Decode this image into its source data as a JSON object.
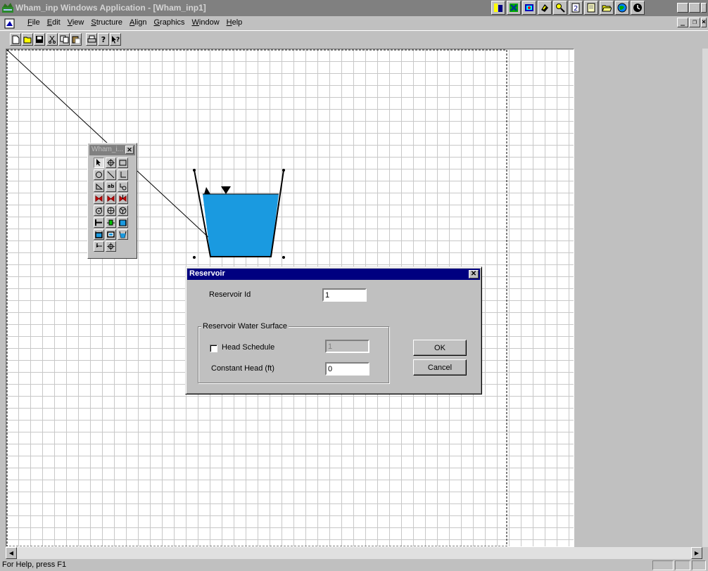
{
  "window": {
    "title": "Wham_inp Windows Application - [Wham_inp1]",
    "title_bar_color": "#808080"
  },
  "office_shortcut_bar": [
    "office-icon",
    "excel-icon",
    "schedule-icon",
    "binder-icon",
    "search-icon",
    "help-icon",
    "document-icon",
    "open-folder-icon",
    "internet-icon",
    "clock-icon"
  ],
  "menu": [
    {
      "accel": "F",
      "rest": "ile"
    },
    {
      "accel": "E",
      "rest": "dit"
    },
    {
      "accel": "V",
      "rest": "iew"
    },
    {
      "accel": "S",
      "rest": "tructure"
    },
    {
      "accel": "A",
      "rest": "lign"
    },
    {
      "accel": "G",
      "rest": "raphics"
    },
    {
      "accel": "W",
      "rest": "indow"
    },
    {
      "accel": "H",
      "rest": "elp"
    }
  ],
  "toolbar": {
    "buttons": [
      "new-file-icon",
      "open-file-icon",
      "save-icon",
      "cut-icon",
      "copy-icon",
      "paste-icon",
      "print-icon",
      "about-icon",
      "context-help-icon"
    ]
  },
  "palette": {
    "title": "Wham_i...",
    "close": "✕",
    "tools": [
      "select-arrow-icon",
      "node-icon",
      "rectangle-icon",
      "circle-icon",
      "line-icon",
      "elbow-line-icon",
      "triangle-icon",
      "text-tool-icon",
      "junction-tool-icon",
      "valve-red-icon",
      "check-valve-red-icon",
      "relief-valve-red-icon",
      "pump-icon",
      "turbine-icon",
      "fan-icon",
      "pipe-tee-icon",
      "pipe-green-icon",
      "tank-blue-icon",
      "surge-tank-blue-icon",
      "box-blue-icon",
      "reservoir-blue-icon",
      "pointer-tool-icon",
      "crosshair-tool-icon"
    ]
  },
  "dialog": {
    "title": "Reservoir",
    "close": "✕",
    "reservoir_id_label": "Reservoir Id",
    "reservoir_id_value": "1",
    "group_label": "Reservoir Water Surface",
    "head_schedule_label": "Head Schedule",
    "head_schedule_checked": false,
    "head_schedule_value": "1",
    "constant_head_label": "Constant Head (ft)",
    "constant_head_value": "0",
    "ok_label": "OK",
    "cancel_label": "Cancel"
  },
  "status": {
    "text": "For Help, press F1"
  },
  "colors": {
    "water": "#1a9ae0",
    "dialog_title": "#000080",
    "grid_line": "#c8c8c8"
  }
}
